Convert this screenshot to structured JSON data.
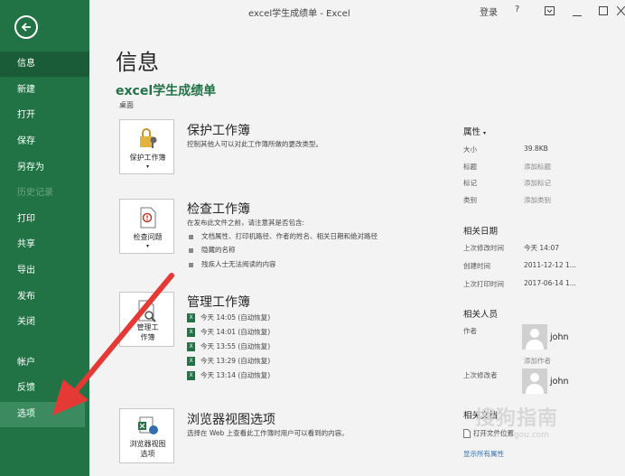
{
  "window": {
    "title": "excel学生成绩单 - Excel",
    "signin": "登录",
    "help": "?"
  },
  "sidebar": {
    "items": [
      {
        "label": "信息",
        "state": "active"
      },
      {
        "label": "新建"
      },
      {
        "label": "打开"
      },
      {
        "label": "保存"
      },
      {
        "label": "另存为"
      },
      {
        "label": "历史记录",
        "state": "disabled"
      },
      {
        "label": "打印"
      },
      {
        "label": "共享"
      },
      {
        "label": "导出"
      },
      {
        "label": "发布"
      },
      {
        "label": "关闭"
      },
      {
        "label": "帐户"
      },
      {
        "label": "反馈"
      },
      {
        "label": "选项",
        "state": "hover"
      }
    ]
  },
  "page": {
    "title": "信息",
    "file_name": "excel学生成绩单",
    "file_location": "桌面"
  },
  "protect": {
    "button": "保护工作簿",
    "title": "保护工作簿",
    "desc": "控制其他人可以对此工作簿所做的更改类型。"
  },
  "inspect": {
    "button": "检查问题",
    "title": "检查工作簿",
    "desc": "在发布此文件之前，请注意其是否包含:",
    "bullets": [
      "文档属性、打印机路径、作者的姓名、相关日期和绝对路径",
      "隐藏的名称",
      "残疾人士无法阅读的内容"
    ]
  },
  "manage": {
    "button_line1": "管理工",
    "button_line2": "作簿",
    "title": "管理工作簿",
    "versions": [
      "今天 14:05 (自动恢复)",
      "今天 14:01 (自动恢复)",
      "今天 13:55 (自动恢复)",
      "今天 13:29 (自动恢复)",
      "今天 13:14 (自动恢复)"
    ]
  },
  "browser": {
    "button_line1": "浏览器视图",
    "button_line2": "选项",
    "title": "浏览器视图选项",
    "desc": "选择在 Web 上查看此工作簿时用户可以看到的内容。"
  },
  "properties": {
    "header": "属性",
    "rows": [
      {
        "key": "大小",
        "value": "39.8KB"
      },
      {
        "key": "标题",
        "value": "添加标题"
      },
      {
        "key": "标记",
        "value": "添加标记"
      },
      {
        "key": "类别",
        "value": "添加类别"
      }
    ]
  },
  "dates": {
    "header": "相关日期",
    "rows": [
      {
        "key": "上次修改时间",
        "value": "今天 14:07"
      },
      {
        "key": "创建时间",
        "value": "2011-12-12 1..."
      },
      {
        "key": "上次打印时间",
        "value": "2017-06-14 1..."
      }
    ]
  },
  "people": {
    "header": "相关人员",
    "author_label": "作者",
    "author_name": "john",
    "add_author": "添加作者",
    "modifier_label": "上次修改者",
    "modifier_name": "john"
  },
  "related_docs": {
    "header": "相关文档",
    "open_location": "打开文件位置",
    "show_all": "显示所有属性"
  },
  "watermark": {
    "text": "搜狗指南",
    "url": "zhinan.sogou.com"
  },
  "colors": {
    "accent": "#217346",
    "active": "#1a5c38",
    "hover": "#3c8a5f",
    "arrow": "#e53935"
  }
}
